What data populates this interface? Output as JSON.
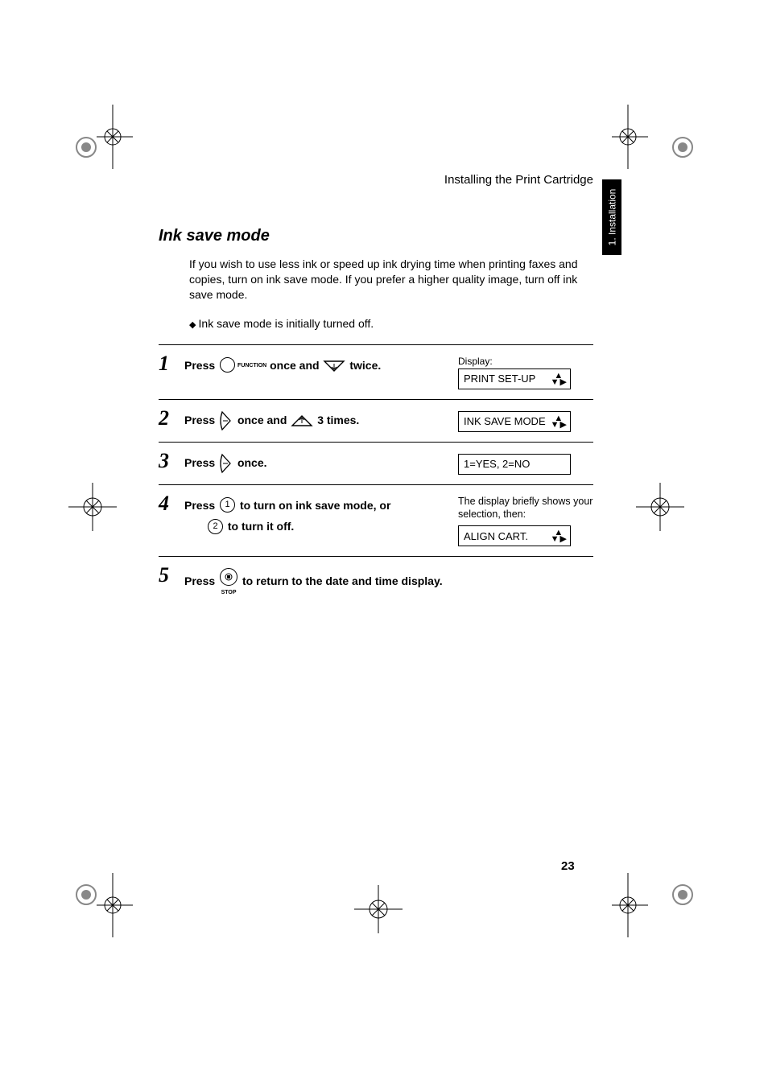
{
  "running_head": "Installing the Print Cartridge",
  "side_tab": "1. Installation",
  "heading": "Ink save mode",
  "intro": "If you wish to use less ink or speed up ink drying time when printing faxes and copies, turn on ink save mode. If you prefer a higher quality image, turn off ink save mode.",
  "note": "Ink save mode is initially turned off.",
  "steps": {
    "s1": {
      "n": "1",
      "a": "Press ",
      "func": "FUNCTION",
      "b": " once and ",
      "c": " twice.",
      "display_label": "Display:",
      "display": "PRINT SET-UP"
    },
    "s2": {
      "n": "2",
      "a": "Press ",
      "b": " once and ",
      "c": " 3 times.",
      "display": "INK SAVE MODE"
    },
    "s3": {
      "n": "3",
      "a": "Press ",
      "b": " once.",
      "display": "1=YES, 2=NO"
    },
    "s4": {
      "n": "4",
      "a": "Press ",
      "key1": "1",
      "b": " to turn on ink save mode, or",
      "key2": "2",
      "c": " to turn it off.",
      "note": "The display briefly shows your selection, then:",
      "display": "ALIGN CART."
    },
    "s5": {
      "n": "5",
      "a": "Press ",
      "stop": "STOP",
      "b": " to return to the date and time display."
    }
  },
  "page_number": "23"
}
